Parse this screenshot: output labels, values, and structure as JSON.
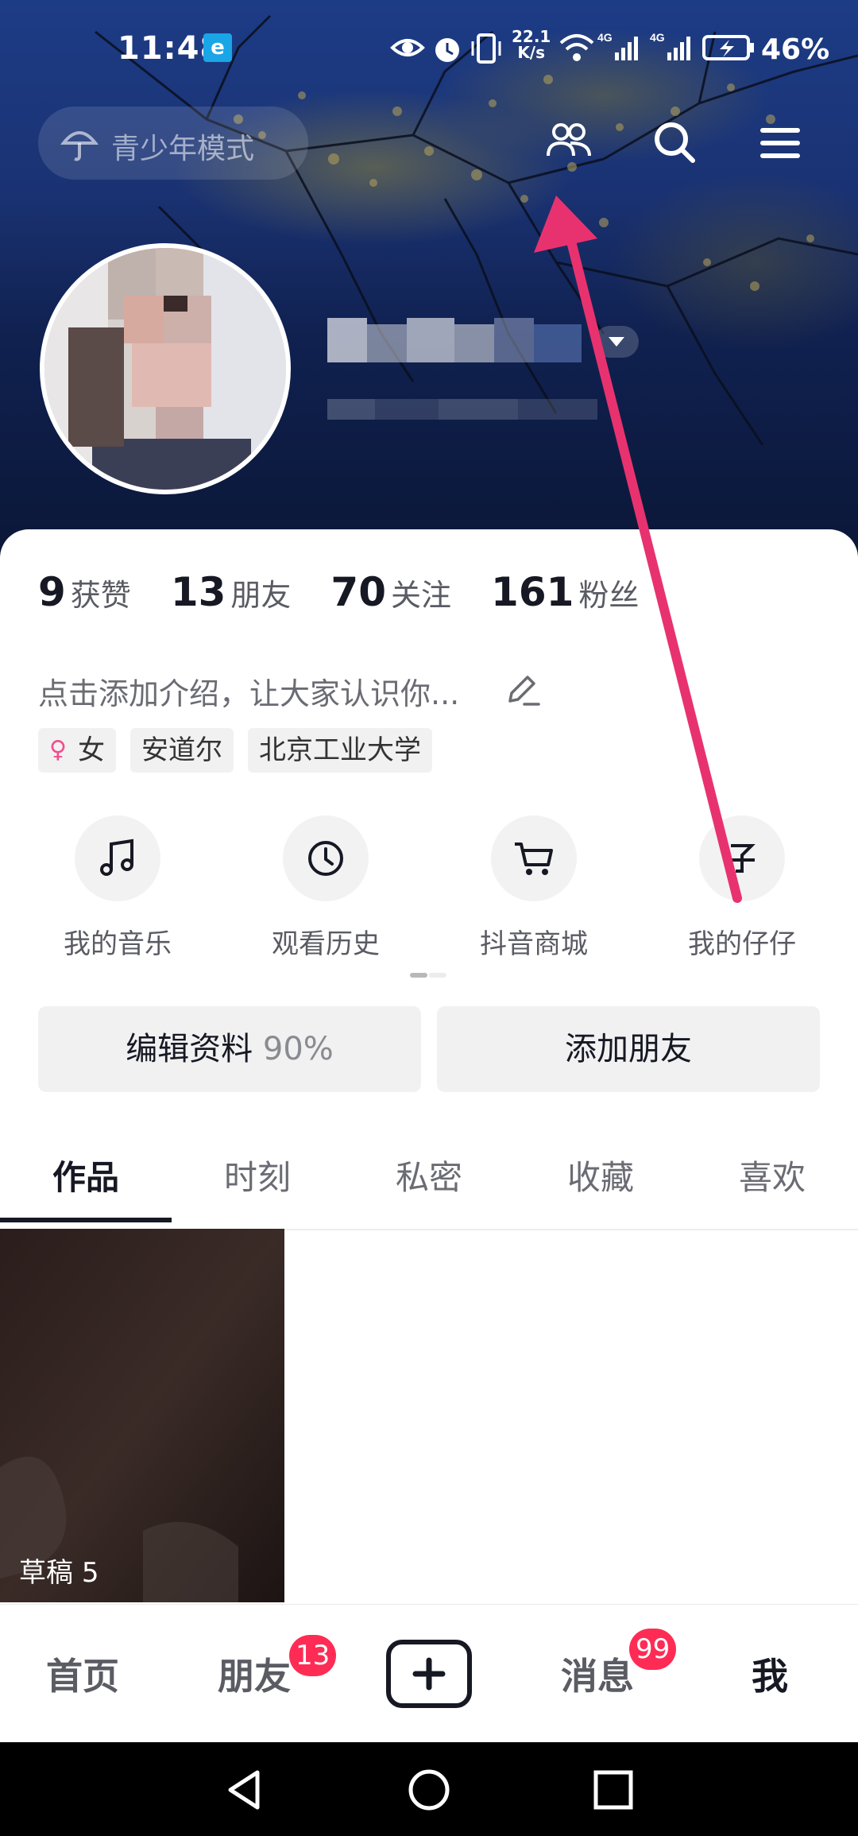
{
  "status_bar": {
    "time": "11:48",
    "net_speed_value": "22.1",
    "net_speed_unit": "K/s",
    "signal_1": "4G",
    "signal_2": "4G",
    "battery": "46%"
  },
  "header": {
    "teen_mode_label": "青少年模式",
    "icons": [
      "friends-icon",
      "search-icon",
      "menu-icon"
    ]
  },
  "stats": [
    {
      "num": "9",
      "label": "获赞"
    },
    {
      "num": "13",
      "label": "朋友"
    },
    {
      "num": "70",
      "label": "关注"
    },
    {
      "num": "161",
      "label": "粉丝"
    }
  ],
  "bio": "点击添加介绍，让大家认识你...",
  "tags": {
    "gender": "女",
    "location": "安道尔",
    "school": "北京工业大学"
  },
  "shortcuts": [
    {
      "label": "我的音乐",
      "icon": "music-note-icon"
    },
    {
      "label": "观看历史",
      "icon": "clock-icon"
    },
    {
      "label": "抖音商城",
      "icon": "cart-icon"
    },
    {
      "label": "我的仔仔",
      "icon": "zaizai-icon"
    }
  ],
  "buttons": {
    "edit_profile": "编辑资料",
    "edit_profile_pct": "90%",
    "add_friends": "添加朋友"
  },
  "tabs": [
    "作品",
    "时刻",
    "私密",
    "收藏",
    "喜欢"
  ],
  "active_tab": "作品",
  "grid": {
    "draft_label": "草稿",
    "draft_count": "5"
  },
  "bottom_nav": {
    "home": "首页",
    "friends": "朋友",
    "friends_badge": "13",
    "messages": "消息",
    "messages_badge": "99",
    "me": "我"
  },
  "colors": {
    "accent": "#fe2c55",
    "annotation_arrow": "#e8326f",
    "text_primary": "#161823"
  }
}
